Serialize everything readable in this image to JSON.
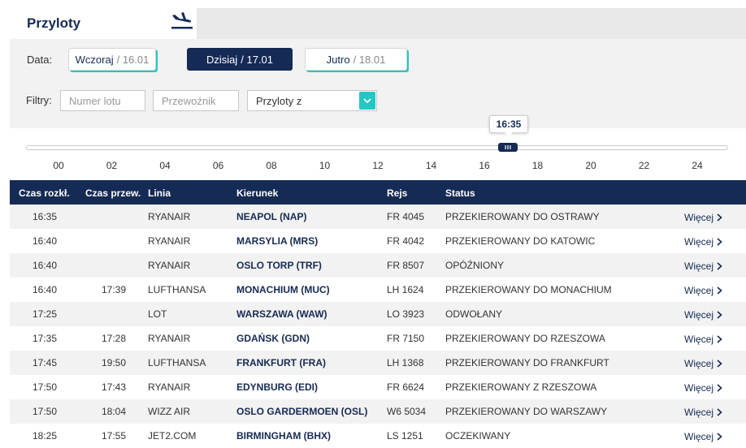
{
  "header": {
    "title": "Przyloty",
    "icon": "plane-landing-icon"
  },
  "dates": {
    "label": "Data:",
    "items": [
      {
        "name": "Wczoraj",
        "date": "/ 16.01"
      },
      {
        "name": "Dzisiaj",
        "date": "/ 17.01"
      },
      {
        "name": "Jutro",
        "date": "/ 18.01"
      }
    ],
    "selected": "Dzisiaj"
  },
  "filters": {
    "label": "Filtry:",
    "flight_placeholder": "Numer lotu",
    "carrier_placeholder": "Przewoźnik",
    "origin_value": "Przyloty z"
  },
  "slider": {
    "value": "16:35",
    "ticks": [
      "00",
      "02",
      "04",
      "06",
      "08",
      "10",
      "12",
      "14",
      "16",
      "18",
      "20",
      "22",
      "24"
    ]
  },
  "table": {
    "headers": [
      "Czas rozkł.",
      "Czas przew.",
      "Linia",
      "Kierunek",
      "Rejs",
      "Status"
    ],
    "more_label": "Więcej",
    "rows": [
      {
        "sched": "16:35",
        "est": "",
        "airline": "RYANAIR",
        "dest": "NEAPOL (NAP)",
        "flight": "FR 4045",
        "status": "PRZEKIEROWANY DO OSTRAWY"
      },
      {
        "sched": "16:40",
        "est": "",
        "airline": "RYANAIR",
        "dest": "MARSYLIA (MRS)",
        "flight": "FR 4042",
        "status": "PRZEKIEROWANY DO KATOWIC"
      },
      {
        "sched": "16:40",
        "est": "",
        "airline": "RYANAIR",
        "dest": "OSLO TORP (TRF)",
        "flight": "FR 8507",
        "status": "OPÓŹNIONY"
      },
      {
        "sched": "16:40",
        "est": "17:39",
        "airline": "LUFTHANSA",
        "dest": "MONACHIUM (MUC)",
        "flight": "LH 1624",
        "status": "PRZEKIEROWANY DO MONACHIUM"
      },
      {
        "sched": "17:25",
        "est": "",
        "airline": "LOT",
        "dest": "WARSZAWA (WAW)",
        "flight": "LO 3923",
        "status": "ODWOŁANY"
      },
      {
        "sched": "17:35",
        "est": "17:28",
        "airline": "RYANAIR",
        "dest": "GDAŃSK (GDN)",
        "flight": "FR 7150",
        "status": "PRZEKIEROWANY DO RZESZOWA"
      },
      {
        "sched": "17:45",
        "est": "19:50",
        "airline": "LUFTHANSA",
        "dest": "FRANKFURT (FRA)",
        "flight": "LH 1368",
        "status": "PRZEKIEROWANY DO FRANKFURT"
      },
      {
        "sched": "17:50",
        "est": "17:43",
        "airline": "RYANAIR",
        "dest": "EDYNBURG (EDI)",
        "flight": "FR 6624",
        "status": "PRZEKIEROWANY Z RZESZOWA"
      },
      {
        "sched": "17:50",
        "est": "18:04",
        "airline": "WIZZ AIR",
        "dest": "OSLO GARDERMOEN (OSL)",
        "flight": "W6 5034",
        "status": "PRZEKIEROWANY DO WARSZAWY"
      },
      {
        "sched": "18:25",
        "est": "17:55",
        "airline": "JET2.COM",
        "dest": "BIRMINGHAM (BHX)",
        "flight": "LS 1251",
        "status": "OCZEKIWANY"
      }
    ]
  },
  "colors": {
    "navy": "#152a54",
    "teal": "#25c7c3",
    "panel": "#f2f2f2"
  }
}
